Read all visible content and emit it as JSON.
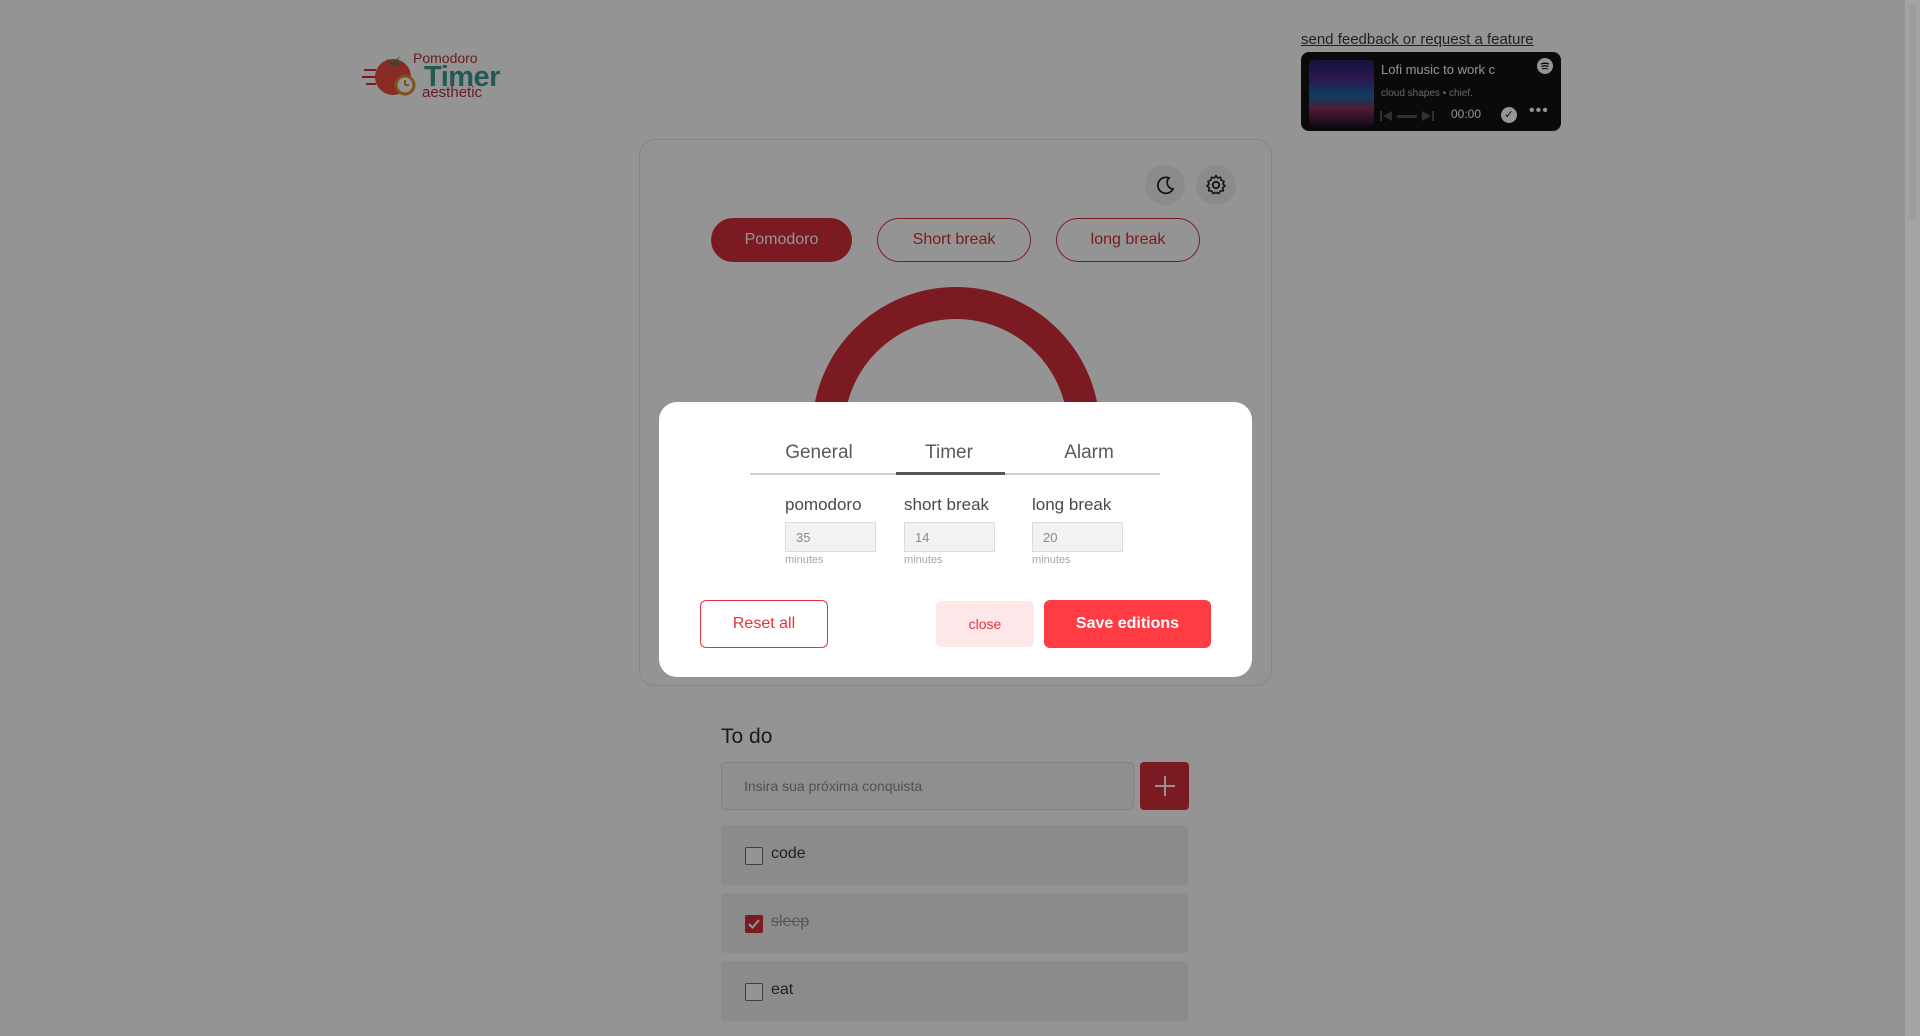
{
  "logo": {
    "line1": "Pomodoro",
    "line2": "Timer",
    "line3": "aesthetic"
  },
  "header": {
    "feedback_link": "send feedback or request a feature"
  },
  "player": {
    "title": "Lofi music to work c",
    "artist": "cloud shapes • chief.",
    "time": "00:00",
    "icons": [
      "spotify-icon",
      "previous-icon",
      "progress-bar",
      "next-icon",
      "save-check-icon",
      "more-icon"
    ]
  },
  "timer_card": {
    "icons": [
      "moon-icon",
      "gear-icon"
    ],
    "modes": [
      "Pomodoro",
      "Short break",
      "long break"
    ],
    "active_mode": "Pomodoro"
  },
  "settings_modal": {
    "tabs": [
      "General",
      "Timer",
      "Alarm"
    ],
    "active_tab": "Timer",
    "fields": [
      {
        "label": "pomodoro",
        "value": "35",
        "hint": "minutes"
      },
      {
        "label": "short break",
        "value": "14",
        "hint": "minutes"
      },
      {
        "label": "long break",
        "value": "20",
        "hint": "minutes"
      }
    ],
    "reset_label": "Reset all",
    "close_label": "close",
    "save_label": "Save editions"
  },
  "todo": {
    "title": "To do",
    "placeholder": "Insira sua próxima conquista",
    "tasks": [
      {
        "label": "code",
        "done": false
      },
      {
        "label": "sleep",
        "done": true
      },
      {
        "label": "eat",
        "done": false
      }
    ]
  },
  "colors": {
    "accent": "#d52f3a",
    "save_button": "#ff3b44",
    "overlay": "rgba(0,0,0,0.42)"
  }
}
